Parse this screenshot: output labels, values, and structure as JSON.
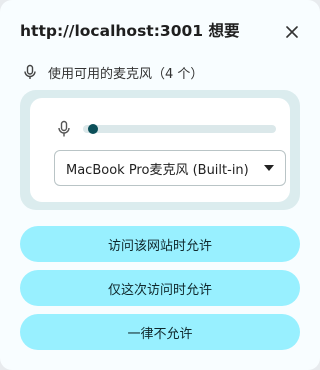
{
  "dialog": {
    "title": "http://localhost:3001 想要",
    "close_icon": "close-icon",
    "permission": {
      "icon": "microphone-icon",
      "text": "使用可用的麦克风（4 个）"
    },
    "mic_panel": {
      "level_icon": "microphone-icon",
      "level_fraction": 0.03,
      "selected_device": "MacBook Pro麦克风 (Built-in)"
    },
    "buttons": {
      "allow_site": "访问该网站时允许",
      "allow_this_time": "仅这次访问时允许",
      "never_allow": "一律不允许"
    },
    "colors": {
      "button_bg": "#98f0ff",
      "panel_bg": "#dbecee",
      "level_dot": "#0b4f59"
    }
  }
}
